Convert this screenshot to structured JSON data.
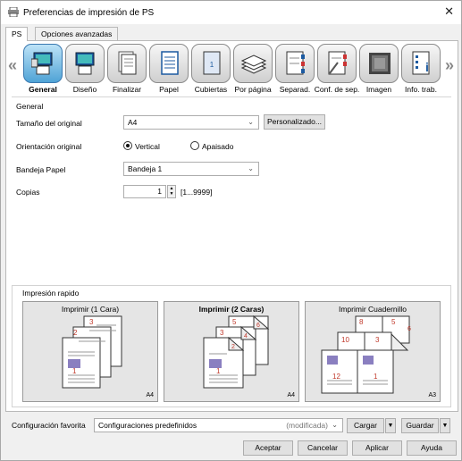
{
  "window": {
    "title": "Preferencias de impresión de PS",
    "close": "✕"
  },
  "tabs": [
    {
      "label": "PS"
    },
    {
      "label": "Opciones avanzadas"
    }
  ],
  "toolbar": {
    "items": [
      {
        "label": "General"
      },
      {
        "label": "Diseño"
      },
      {
        "label": "Finalizar"
      },
      {
        "label": "Papel"
      },
      {
        "label": "Cubiertas"
      },
      {
        "label": "Por página"
      },
      {
        "label": "Separad."
      },
      {
        "label": "Conf. de sep."
      },
      {
        "label": "Imagen"
      },
      {
        "label": "Info. trab."
      }
    ],
    "left_arrow": "«",
    "right_arrow": "»"
  },
  "general": {
    "group_title": "General",
    "original_size": {
      "label": "Tamaño del original",
      "value": "A4",
      "custom_button": "Personalizado..."
    },
    "orientation": {
      "label": "Orientación original",
      "vertical": "Vertical",
      "landscape": "Apaisado",
      "selected": "Vertical"
    },
    "tray": {
      "label": "Bandeja Papel",
      "value": "Bandeja 1"
    },
    "copies": {
      "label": "Copias",
      "value": "1",
      "range": "[1...9999]"
    }
  },
  "quick_print": {
    "title": "Impresión rapido",
    "options": [
      {
        "label": "Imprimir (1 Cara)",
        "size": "A4",
        "selected": false,
        "pages": [
          "3",
          "2",
          "1"
        ]
      },
      {
        "label": "Imprimir (2 Caras)",
        "size": "A4",
        "selected": true,
        "pages": [
          "5",
          "6",
          "3",
          "4",
          "1",
          "2"
        ]
      },
      {
        "label": "Imprimir Cuadernillo",
        "size": "A3",
        "selected": false,
        "pages": [
          "8",
          "5",
          "6",
          "10",
          "3",
          "12",
          "1"
        ]
      }
    ]
  },
  "favorites": {
    "label": "Configuración favorita",
    "value": "Configuraciones predefinidos",
    "modified": "(modificada)",
    "load_button": "Cargar",
    "save_button": "Guardar"
  },
  "dialog_buttons": {
    "ok": "Aceptar",
    "cancel": "Cancelar",
    "apply": "Aplicar",
    "help": "Ayuda"
  },
  "colors": {
    "accent": "#3a79b0",
    "page_number": "#c0392b"
  }
}
